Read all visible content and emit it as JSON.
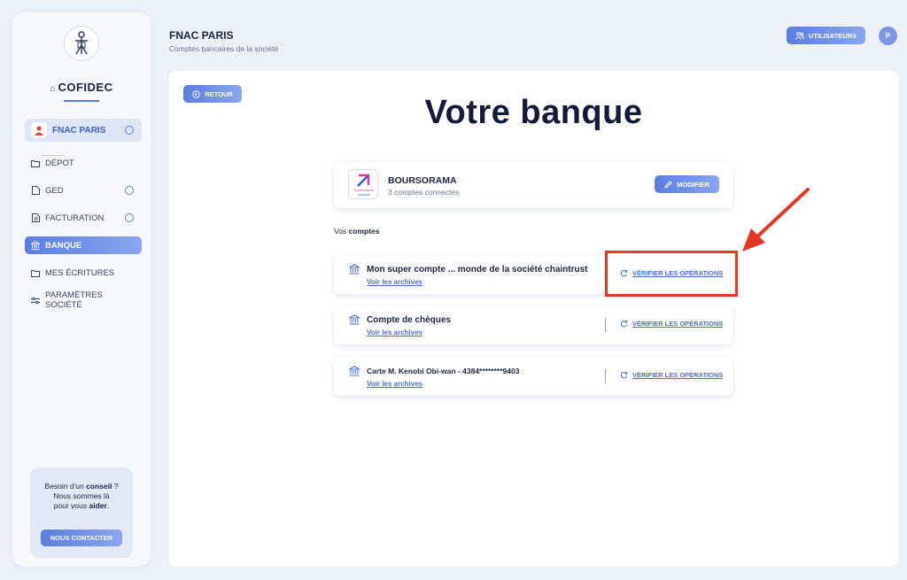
{
  "sidebar": {
    "brand": "COFIDEC",
    "company": "FNAC PARIS",
    "items": [
      {
        "label": "DÉPOT",
        "icon": "folder-icon",
        "chevron": false
      },
      {
        "label": "GED",
        "icon": "document-icon",
        "chevron": true
      },
      {
        "label": "FACTURATION",
        "icon": "invoice-icon",
        "chevron": true
      },
      {
        "label": "BANQUE",
        "icon": "bank-icon",
        "chevron": false,
        "active": true
      },
      {
        "label": "MES ÉCRITURES",
        "icon": "folder-icon",
        "chevron": false
      },
      {
        "label": "PARAMÈTRES SOCIÉTÉ",
        "icon": "sliders-icon",
        "chevron": false
      }
    ],
    "help": {
      "line1_pre": "Besoin d'un ",
      "line1_bold": "conseil",
      "line1_post": " ?",
      "line2": "Nous sommes là",
      "line3_pre": "pour vous ",
      "line3_bold": "aider",
      "line3_post": ".",
      "button": "NOUS CONTACTER"
    }
  },
  "header": {
    "title": "FNAC PARIS",
    "subtitle": "Comptes bancaires de la société",
    "users_button": "UTILISATEURS",
    "profile_initial": "P"
  },
  "main": {
    "back_button": "RETOUR",
    "title": "Votre banque",
    "bank": {
      "name": "BOURSORAMA",
      "connected": "3 comptes connectés",
      "logo_text_1": "Boursorama",
      "logo_text_2": "Banque",
      "edit_button": "MODIFIER"
    },
    "section_pre": "Vos ",
    "section_bold": "comptes",
    "accounts": [
      {
        "name": "Mon super compte ... monde de la société chaintrust",
        "link": "Voir les archives",
        "verify": "VÉRIFIER LES OPÉRATIONS"
      },
      {
        "name": "Compte de chèques",
        "link": "Voir les archives",
        "verify": "VÉRIFIER LES OPÉRATIONS"
      },
      {
        "name": "Carte M. Kenobi Obi-wan - 4384********9403",
        "link": "Voir les archives",
        "verify": "VÉRIFIER LES OPÉRATIONS"
      }
    ]
  },
  "colors": {
    "accent": "#5a7de0",
    "highlight": "#e53722",
    "text": "#1c2340"
  }
}
